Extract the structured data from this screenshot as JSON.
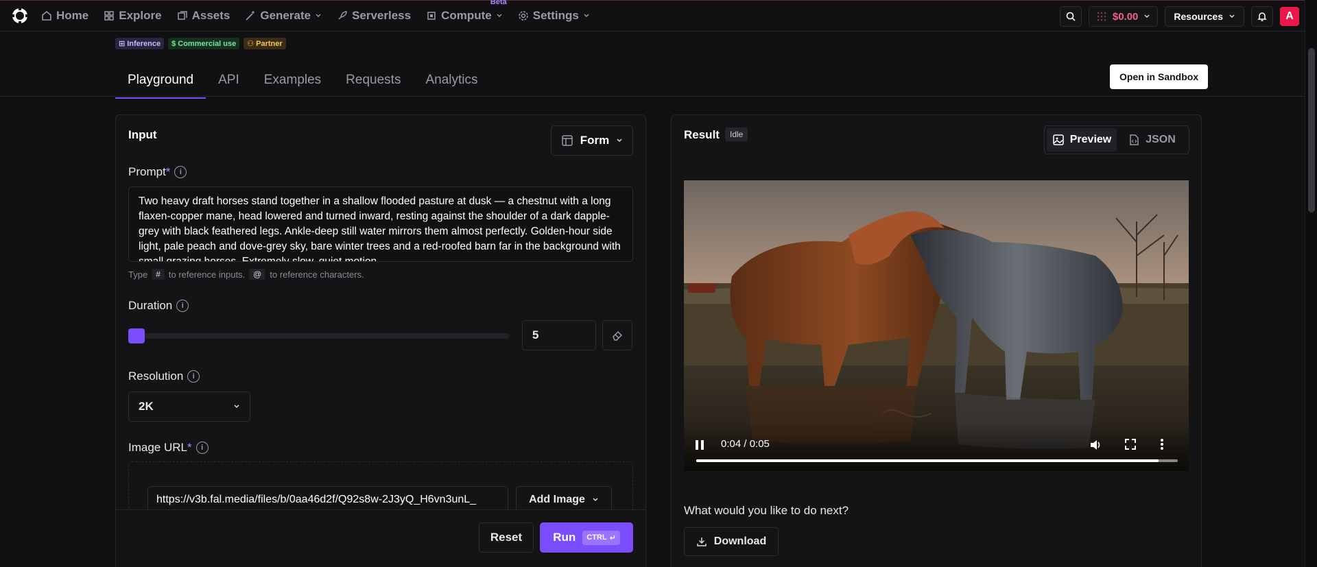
{
  "nav": {
    "items": [
      {
        "label": "Home",
        "icon": "home-icon"
      },
      {
        "label": "Explore",
        "icon": "grid-icon"
      },
      {
        "label": "Assets",
        "icon": "assets-icon"
      },
      {
        "label": "Generate",
        "icon": "wand-icon"
      },
      {
        "label": "Serverless",
        "icon": "rocket-icon"
      },
      {
        "label": "Compute",
        "icon": "chip-icon"
      },
      {
        "label": "Settings",
        "icon": "gear-icon"
      }
    ],
    "beta_label": "Beta",
    "credits": "$0.00",
    "resources_label": "Resources",
    "avatar_letter": "A"
  },
  "badges": {
    "inference": "Inference",
    "commercial": "Commercial use",
    "partner": "Partner"
  },
  "tabs": [
    "Playground",
    "API",
    "Examples",
    "Requests",
    "Analytics"
  ],
  "sandbox_label": "Open in Sandbox",
  "input": {
    "title": "Input",
    "form_label": "Form",
    "prompt": {
      "label": "Prompt",
      "value": "Two heavy draft horses stand together in a shallow flooded pasture at dusk — a chestnut with a long flaxen-copper mane, head lowered and turned inward, resting against the shoulder of a dark dapple-grey with black feathered legs. Ankle-deep still water mirrors them almost perfectly. Golden-hour side light, pale peach and dove-grey sky, bare winter trees and a red-roofed barn far in the background with small grazing horses. Extremely slow, quiet motion.",
      "hint_before": "Type",
      "hint_hash": "#",
      "hint_mid": "to reference inputs.",
      "hint_at": "@",
      "hint_after": "to reference characters."
    },
    "duration": {
      "label": "Duration",
      "value": "5"
    },
    "resolution": {
      "label": "Resolution",
      "value": "2K"
    },
    "image_url": {
      "label": "Image URL",
      "value": "https://v3b.fal.media/files/b/0aa46d2f/Q92s8w-2J3yQ_H6vn3unL_",
      "add_label": "Add Image"
    },
    "reset_label": "Reset",
    "run_label": "Run",
    "run_shortcut": "CTRL"
  },
  "result": {
    "title": "Result",
    "status": "Idle",
    "preview_label": "Preview",
    "json_label": "JSON",
    "video_time": "0:04 / 0:05",
    "video_progress": 0.96,
    "next_question": "What would you like to do next?",
    "download_label": "Download"
  }
}
